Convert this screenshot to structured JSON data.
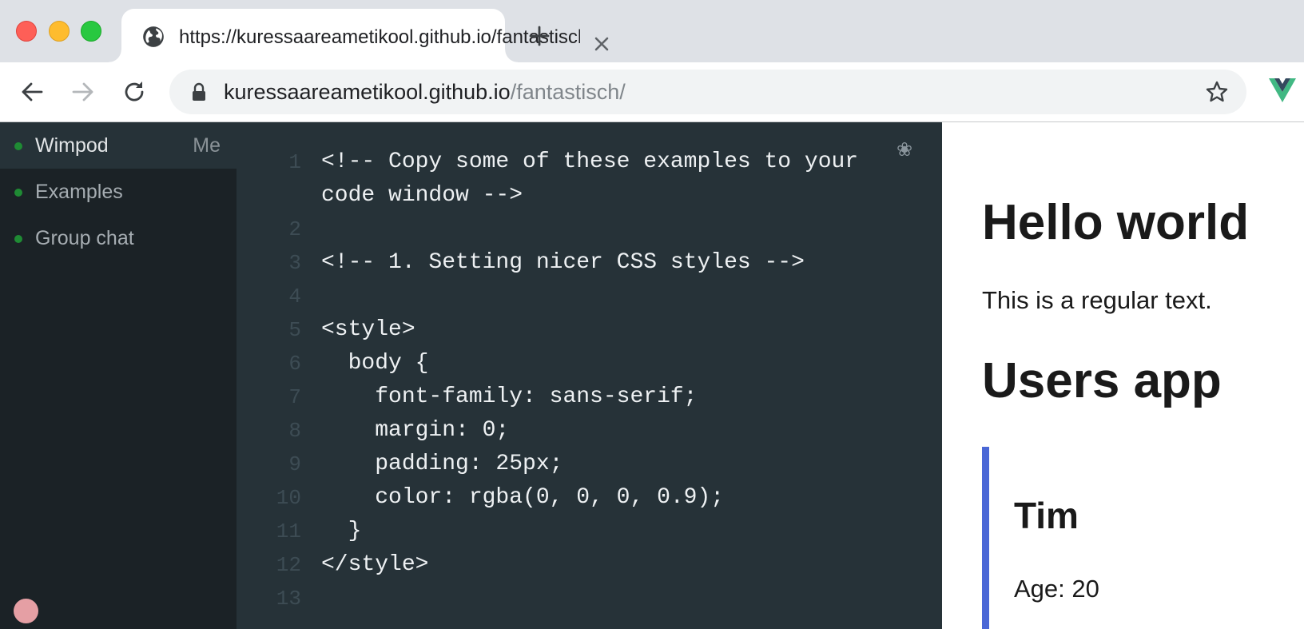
{
  "browser": {
    "tab": {
      "title": "https://kuressaareametikool.github.io/fantastisch/",
      "icon": "globe-icon"
    },
    "address": {
      "host": "kuressaareametikool.github.io",
      "path": "/fantastisch/"
    }
  },
  "sidebar": {
    "items": [
      {
        "label": "Wimpod",
        "badge": "Me",
        "active": true
      },
      {
        "label": "Examples"
      },
      {
        "label": "Group chat"
      }
    ],
    "status_color": "#1f8b34",
    "user_avatar_color": "#e59fa4"
  },
  "editor": {
    "settings_icon": "❀",
    "lines": [
      {
        "n": "1",
        "text": "<!-- Copy some of these examples to your"
      },
      {
        "n": "",
        "text": "code window -->"
      },
      {
        "n": "2",
        "text": ""
      },
      {
        "n": "3",
        "text": "<!-- 1. Setting nicer CSS styles -->"
      },
      {
        "n": "4",
        "text": ""
      },
      {
        "n": "5",
        "text": "<style>"
      },
      {
        "n": "6",
        "text": "  body {"
      },
      {
        "n": "7",
        "text": "    font-family: sans-serif;"
      },
      {
        "n": "8",
        "text": "    margin: 0;"
      },
      {
        "n": "9",
        "text": "    padding: 25px;"
      },
      {
        "n": "10",
        "text": "    color: rgba(0, 0, 0, 0.9);"
      },
      {
        "n": "11",
        "text": "  }"
      },
      {
        "n": "12",
        "text": "</style>"
      },
      {
        "n": "13",
        "text": ""
      }
    ]
  },
  "preview": {
    "heading1": "Hello world",
    "paragraph": "This is a regular text.",
    "heading2": "Users app",
    "user": {
      "name": "Tim",
      "age": "Age: 20"
    },
    "accent_color": "#4a67d6"
  }
}
